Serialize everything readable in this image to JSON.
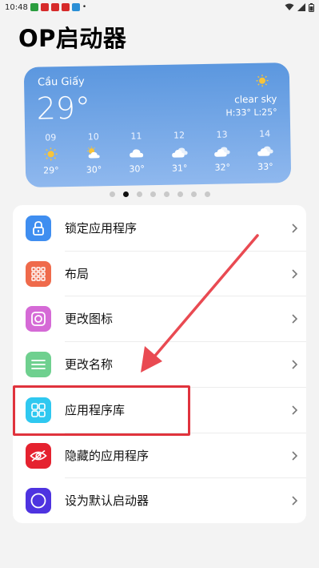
{
  "status_bar": {
    "time": "10:48",
    "notification_icon_colors": [
      "#2a9d3f",
      "#d62a2a",
      "#d62a2a",
      "#d62a2a",
      "#2a8fd6"
    ]
  },
  "header": {
    "title": "OP启动器"
  },
  "weather": {
    "city": "Cầu Giấy",
    "temperature": "29°",
    "condition": "clear sky",
    "high_low": "H:33° L:25°",
    "hourly": [
      {
        "hour": "09",
        "icon": "sun-icon",
        "temp": "29°"
      },
      {
        "hour": "10",
        "icon": "partly-cloudy-icon",
        "temp": "30°"
      },
      {
        "hour": "11",
        "icon": "cloud-icon",
        "temp": "30°"
      },
      {
        "hour": "12",
        "icon": "clouds-icon",
        "temp": "31°"
      },
      {
        "hour": "13",
        "icon": "clouds-icon",
        "temp": "32°"
      },
      {
        "hour": "14",
        "icon": "clouds-icon",
        "temp": "33°"
      }
    ]
  },
  "pager": {
    "count": 8,
    "active_index": 1
  },
  "menu": {
    "items": [
      {
        "label": "锁定应用程序",
        "icon": "lock-icon",
        "color": "#3f8ef0"
      },
      {
        "label": "布局",
        "icon": "grid-icon",
        "color": "#ef6a4b"
      },
      {
        "label": "更改图标",
        "icon": "square-circle-icon",
        "color": "#d56ad6"
      },
      {
        "label": "更改名称",
        "icon": "lines-icon",
        "color": "#6fd08f"
      },
      {
        "label": "应用程序库",
        "icon": "app-library-icon",
        "color": "#2fc8f0"
      },
      {
        "label": "隐藏的应用程序",
        "icon": "hidden-eye-icon",
        "color": "#e5222f"
      },
      {
        "label": "设为默认启动器",
        "icon": "circle-icon",
        "color": "#4e33e0"
      }
    ]
  },
  "annotation": {
    "highlight_color": "#e0333d",
    "highlighted_item": "应用程序库"
  }
}
